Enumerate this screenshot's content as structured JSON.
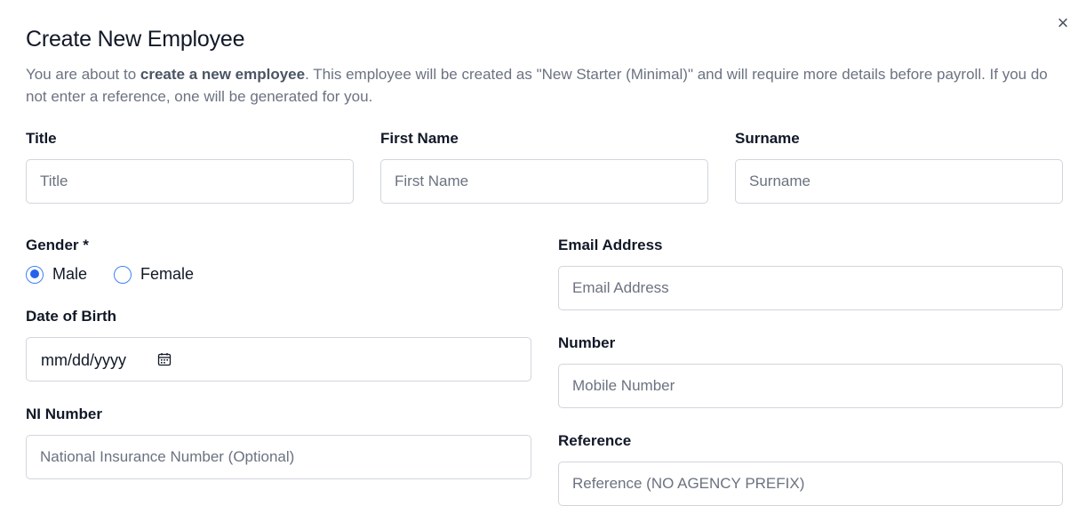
{
  "dialog": {
    "title": "Create New Employee",
    "close_label": "×",
    "description_pre": "You are about to ",
    "description_bold": "create a new employee",
    "description_post": ". This employee will be created as \"New Starter (Minimal)\" and will require more details before payroll. If you do not enter a reference, one will be generated for you."
  },
  "fields": {
    "title": {
      "label": "Title",
      "placeholder": "Title"
    },
    "first_name": {
      "label": "First Name",
      "placeholder": "First Name"
    },
    "surname": {
      "label": "Surname",
      "placeholder": "Surname"
    },
    "gender": {
      "label": "Gender *",
      "options": [
        "Male",
        "Female"
      ],
      "selected": "Male"
    },
    "email": {
      "label": "Email Address",
      "placeholder": "Email Address"
    },
    "dob": {
      "label": "Date of Birth",
      "placeholder": "mm/dd/yyyy"
    },
    "number": {
      "label": "Number",
      "placeholder": "Mobile Number"
    },
    "ni": {
      "label": "NI Number",
      "placeholder": "National Insurance Number (Optional)"
    },
    "reference": {
      "label": "Reference",
      "placeholder": "Reference (NO AGENCY PREFIX)"
    }
  },
  "icons": {
    "close": "close-icon",
    "calendar": "calendar-icon"
  },
  "colors": {
    "radio_accent": "#2563eb",
    "border": "#d1d5db",
    "muted_text": "#6b7280"
  }
}
